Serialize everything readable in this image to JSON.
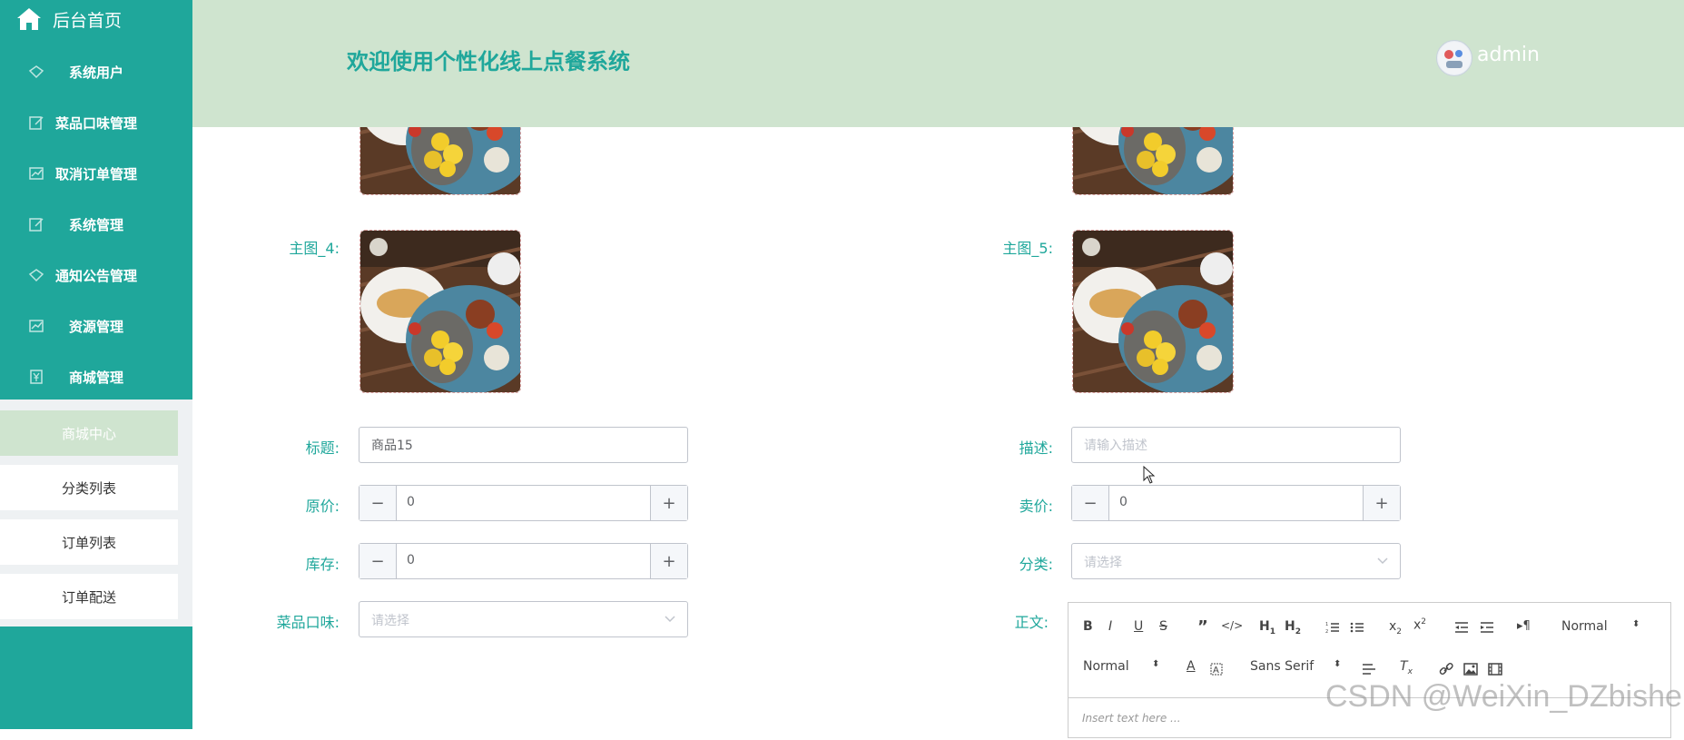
{
  "sidebar": {
    "home_label": "后台首页",
    "menu": [
      {
        "label": "系统用户",
        "icon": "diamond-icon"
      },
      {
        "label": "菜品口味管理",
        "icon": "edit-icon"
      },
      {
        "label": "取消订单管理",
        "icon": "chart-icon"
      },
      {
        "label": "系统管理",
        "icon": "edit-icon"
      },
      {
        "label": "通知公告管理",
        "icon": "diamond-icon"
      },
      {
        "label": "资源管理",
        "icon": "chart-icon"
      },
      {
        "label": "商城管理",
        "icon": "yen-icon"
      }
    ],
    "submenu": [
      {
        "label": "商城中心",
        "active": true
      },
      {
        "label": "分类列表"
      },
      {
        "label": "订单列表"
      },
      {
        "label": "订单配送"
      }
    ]
  },
  "header": {
    "title": "欢迎使用个性化线上点餐系统",
    "user": "admin"
  },
  "form": {
    "main_image_4_label": "主图_4:",
    "main_image_5_label": "主图_5:",
    "title_label": "标题:",
    "title_value": "商品15",
    "desc_label": "描述:",
    "desc_placeholder": "请输入描述",
    "original_price_label": "原价:",
    "original_price_value": "0",
    "sale_price_label": "卖价:",
    "sale_price_value": "0",
    "stock_label": "库存:",
    "stock_value": "0",
    "category_label": "分类:",
    "category_placeholder": "请选择",
    "flavor_label": "菜品口味:",
    "flavor_placeholder": "请选择",
    "content_label": "正文:"
  },
  "editor": {
    "header_select": "Normal",
    "size_select": "Normal",
    "font_select": "Sans Serif",
    "placeholder": "Insert text here ..."
  },
  "watermark": "CSDN @WeiXin_DZbishe",
  "colors": {
    "teal": "#1fa79b",
    "header_bg": "#cfe4cf",
    "submenu_bg": "#eef1f3"
  }
}
